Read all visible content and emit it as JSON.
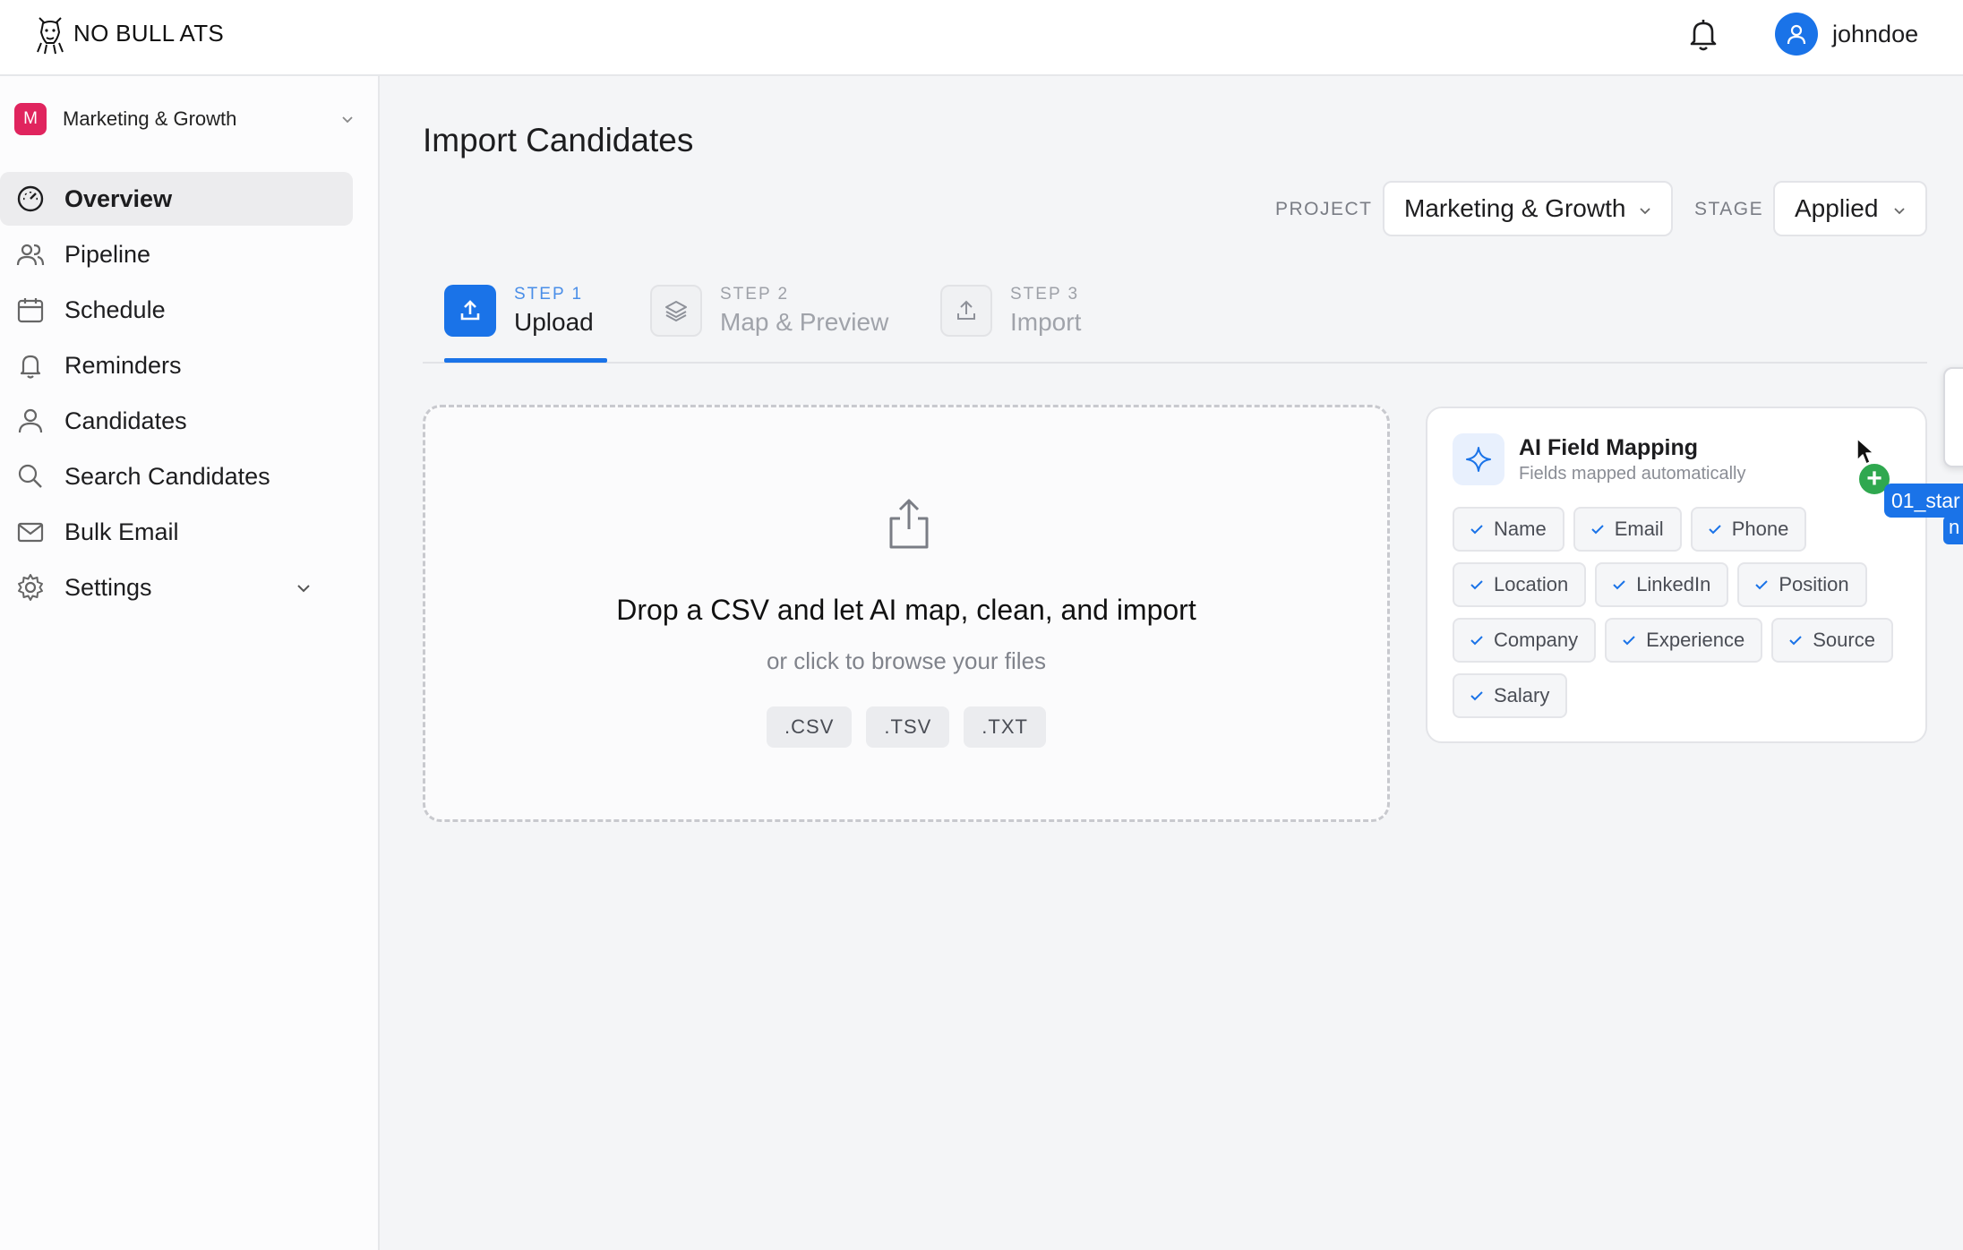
{
  "app": {
    "name": "NO BULL ATS"
  },
  "header": {
    "username": "johndoe"
  },
  "workspace": {
    "badge": "M",
    "name": "Marketing & Growth"
  },
  "nav": [
    {
      "label": "Overview",
      "icon": "gauge-icon",
      "active": true
    },
    {
      "label": "Pipeline",
      "icon": "users-icon"
    },
    {
      "label": "Schedule",
      "icon": "calendar-icon"
    },
    {
      "label": "Reminders",
      "icon": "bell-icon"
    },
    {
      "label": "Candidates",
      "icon": "user-icon"
    },
    {
      "label": "Search Candidates",
      "icon": "search-icon"
    },
    {
      "label": "Bulk Email",
      "icon": "mail-icon"
    },
    {
      "label": "Settings",
      "icon": "gear-icon"
    }
  ],
  "page": {
    "title": "Import Candidates"
  },
  "filters": {
    "project_label": "PROJECT",
    "project_value": "Marketing & Growth",
    "stage_label": "STAGE",
    "stage_value": "Applied"
  },
  "steps": [
    {
      "num": "STEP 1",
      "name": "Upload",
      "active": true
    },
    {
      "num": "STEP 2",
      "name": "Map & Preview"
    },
    {
      "num": "STEP 3",
      "name": "Import"
    }
  ],
  "dropzone": {
    "title": "Drop a CSV and let AI map, clean, and import",
    "subtitle": "or click to browse your files",
    "extensions": [
      ".CSV",
      ".TSV",
      ".TXT"
    ]
  },
  "ai_mapping": {
    "title": "AI Field Mapping",
    "subtitle": "Fields mapped automatically",
    "fields": [
      "Name",
      "Email",
      "Phone",
      "Location",
      "LinkedIn",
      "Position",
      "Company",
      "Experience",
      "Source",
      "Salary"
    ]
  },
  "drag": {
    "file_label": "01_star",
    "second_label": "n"
  },
  "colors": {
    "accent": "#1a73e8",
    "workspace_badge": "#e0245e",
    "drop_plus": "#2fa84f"
  }
}
